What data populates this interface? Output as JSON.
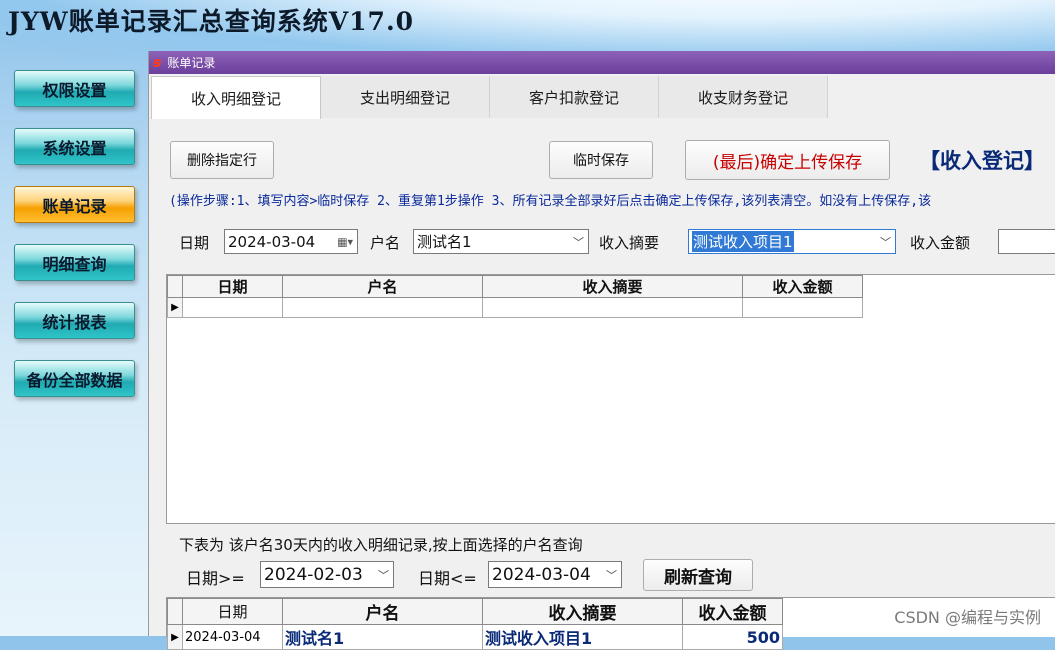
{
  "app": {
    "title": "JYW账单记录汇总查询系统V17.0"
  },
  "nav": {
    "items": [
      {
        "label": "权限设置"
      },
      {
        "label": "系统设置"
      },
      {
        "label": "账单记录",
        "active": true
      },
      {
        "label": "明细查询"
      },
      {
        "label": "统计报表"
      },
      {
        "label": "备份全部数据"
      }
    ]
  },
  "window": {
    "title": "账单记录",
    "icon": "app-logo-icon"
  },
  "tabs": [
    {
      "label": "收入明细登记",
      "active": true
    },
    {
      "label": "支出明细登记"
    },
    {
      "label": "客户扣款登记"
    },
    {
      "label": "收支财务登记"
    }
  ],
  "toolbar": {
    "delete_label": "删除指定行",
    "temp_save_label": "临时保存",
    "upload_label": "(最后)确定上传保存",
    "heading": "【收入登记】"
  },
  "hint": "(操作步骤:1、填写内容>临时保存 2、重复第1步操作 3、所有记录全部录好后点击确定上传保存,该列表清空。如没有上传保存,该",
  "form": {
    "date_label": "日期",
    "date_value": "2024-03-04",
    "name_label": "户名",
    "name_value": "测试名1",
    "summary_label": "收入摘要",
    "summary_value": "测试收入项目1",
    "amount_label": "收入金额",
    "amount_value": ""
  },
  "entry_table": {
    "columns": [
      "日期",
      "户名",
      "收入摘要",
      "收入金额"
    ]
  },
  "history": {
    "note": "下表为 该户名30天内的收入明细记录,按上面选择的户名查询",
    "from_label": "日期>=",
    "from_value": "2024-02-03",
    "to_label": "日期<=",
    "to_value": "2024-03-04",
    "refresh_label": "刷新查询",
    "columns": [
      "日期",
      "户名",
      "收入摘要",
      "收入金额"
    ],
    "rows": [
      {
        "date": "2024-03-04",
        "name": "测试名1",
        "summary": "测试收入项目1",
        "amount": "500"
      }
    ]
  },
  "watermark": "CSDN @编程与实例",
  "colors": {
    "accent": "#0a2a78",
    "title_bar": "#6b3f9b",
    "nav_active": "#f5a000",
    "nav": "#20aab2"
  }
}
